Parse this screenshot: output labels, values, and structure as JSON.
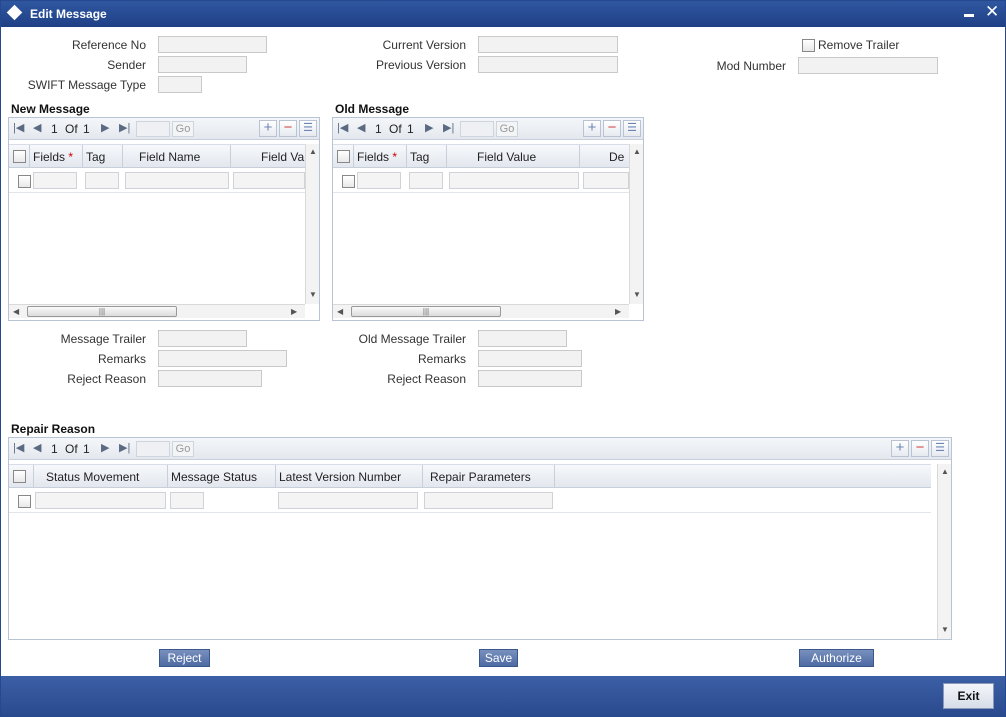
{
  "window": {
    "title": "Edit Message"
  },
  "header": {
    "reference_no_label": "Reference No",
    "sender_label": "Sender",
    "swift_type_label": "SWIFT Message Type",
    "current_version_label": "Current Version",
    "previous_version_label": "Previous Version",
    "remove_trailer_label": "Remove Trailer",
    "mod_number_label": "Mod Number"
  },
  "new_message": {
    "title": "New Message",
    "pager": {
      "page": "1",
      "of_label": "Of",
      "total": "1",
      "go": "Go"
    },
    "columns": [
      "Fields",
      "Tag",
      "Field Name",
      "Field Va"
    ],
    "required_mark": "*"
  },
  "old_message": {
    "title": "Old Message",
    "pager": {
      "page": "1",
      "of_label": "Of",
      "total": "1",
      "go": "Go"
    },
    "columns": [
      "Fields",
      "Tag",
      "Field Value",
      "De"
    ],
    "required_mark": "*"
  },
  "trailer": {
    "message_trailer_label": "Message Trailer",
    "remarks_label": "Remarks",
    "reject_reason_label": "Reject Reason",
    "old_message_trailer_label": "Old Message Trailer",
    "old_remarks_label": "Remarks",
    "old_reject_reason_label": "Reject Reason"
  },
  "repair": {
    "title": "Repair Reason",
    "pager": {
      "page": "1",
      "of_label": "Of",
      "total": "1",
      "go": "Go"
    },
    "columns": [
      "Status Movement",
      "Message Status",
      "Latest Version Number",
      "Repair Parameters"
    ]
  },
  "actions": {
    "reject": "Reject",
    "save": "Save",
    "authorize": "Authorize",
    "exit": "Exit"
  },
  "colors": {
    "titlebar": "#1f4087",
    "footer": "#2a4a8e",
    "button": "#4d6aa3"
  }
}
